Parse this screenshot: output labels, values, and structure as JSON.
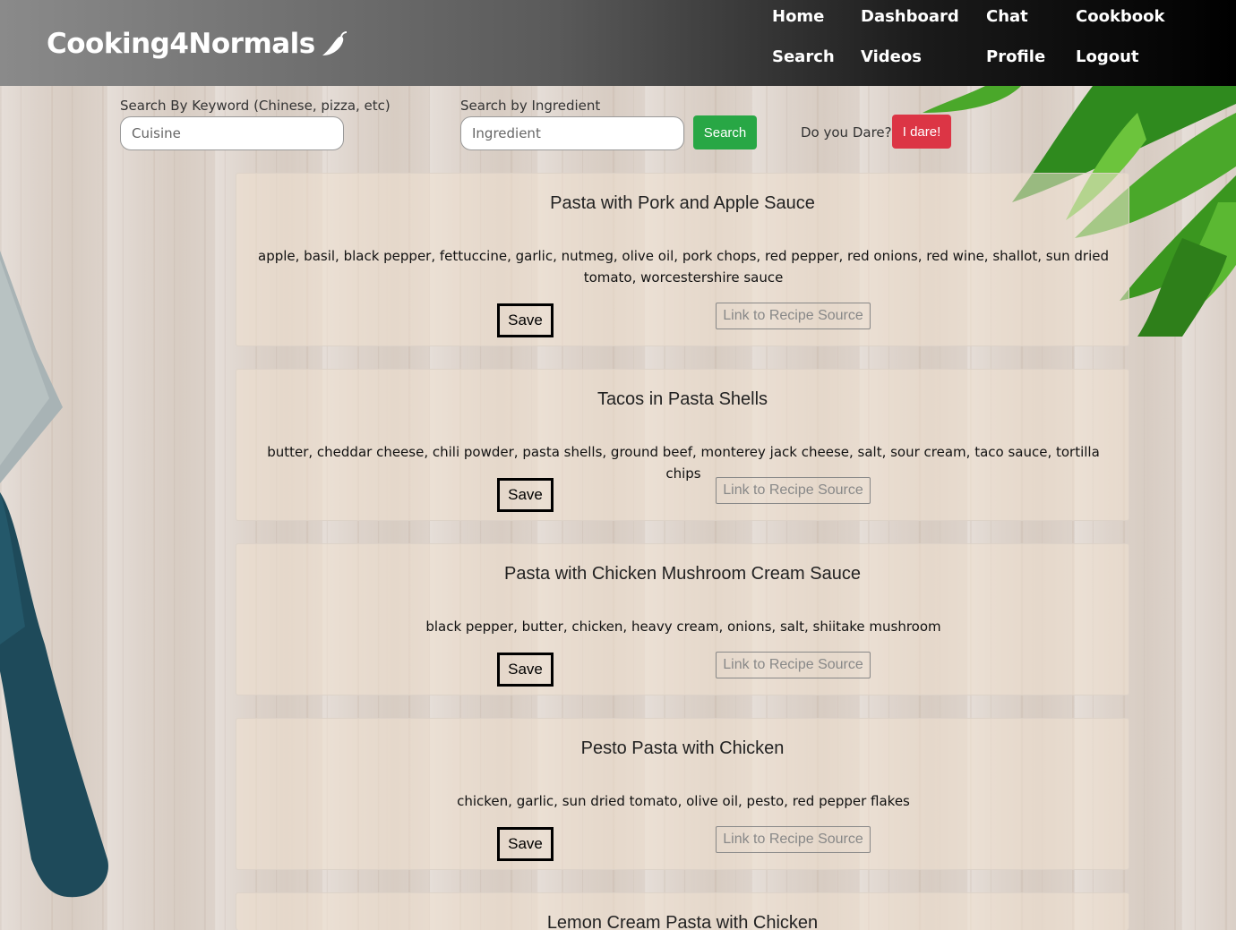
{
  "brand": {
    "name": "Cooking4Normals",
    "icon": "chili-pepper-icon"
  },
  "nav": {
    "home": "Home",
    "dashboard": "Dashboard",
    "chat": "Chat",
    "cookbook": "Cookbook",
    "search": "Search",
    "videos": "Videos",
    "profile": "Profile",
    "logout": "Logout"
  },
  "search": {
    "keyword_label": "Search By Keyword (Chinese, pizza, etc)",
    "keyword_placeholder": "Cuisine",
    "ingredient_label": "Search by Ingredient",
    "ingredient_placeholder": "Ingredient",
    "search_button": "Search",
    "dare_label": "Do you Dare?",
    "dare_button": "I dare!"
  },
  "colors": {
    "search_button": "#28a745",
    "dare_button": "#dc3545"
  },
  "recipes": [
    {
      "title": "Pasta with Pork and Apple Sauce",
      "ingredients": "apple, basil, black pepper, fettuccine, garlic, nutmeg, olive oil, pork chops, red pepper, red onions, red wine, shallot, sun dried tomato, worcestershire sauce",
      "save": "Save",
      "source": "Link to Recipe Source"
    },
    {
      "title": "Tacos in Pasta Shells",
      "ingredients": "butter, cheddar cheese, chili powder, pasta shells, ground beef, monterey jack cheese, salt, sour cream, taco sauce, tortilla chips",
      "save": "Save",
      "source": "Link to Recipe Source"
    },
    {
      "title": "Pasta with Chicken Mushroom Cream Sauce",
      "ingredients": "black pepper, butter, chicken, heavy cream, onions, salt, shiitake mushroom",
      "save": "Save",
      "source": "Link to Recipe Source"
    },
    {
      "title": "Pesto Pasta with Chicken",
      "ingredients": "chicken, garlic, sun dried tomato, olive oil, pesto, red pepper flakes",
      "save": "Save",
      "source": "Link to Recipe Source"
    },
    {
      "title": "Lemon Cream Pasta with Chicken"
    }
  ]
}
